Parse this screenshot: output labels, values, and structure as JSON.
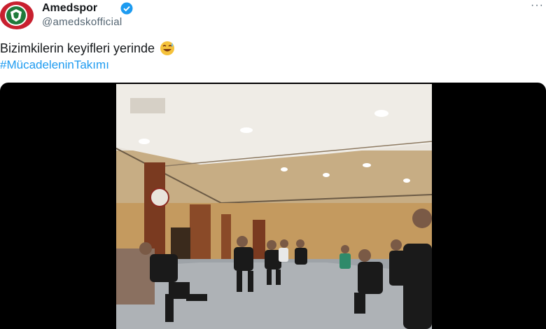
{
  "post": {
    "author": {
      "display_name": "Amedspor",
      "handle": "@amedskofficial",
      "verified": true,
      "avatar_icon": "club-logo-icon"
    },
    "text": "Bizimkilerin keyifleri yerinde",
    "emoji": "grinning-sweat-emoji",
    "hashtag": "#MücadeleninTakımı",
    "more_icon": "more-options-icon"
  },
  "media": {
    "type": "video-still",
    "description_icon": "video-frame"
  },
  "colors": {
    "accent": "#1d9bf0",
    "text": "#14171a",
    "muted": "#536471",
    "brand_red": "#c8202f",
    "brand_green": "#1f7a3a"
  }
}
